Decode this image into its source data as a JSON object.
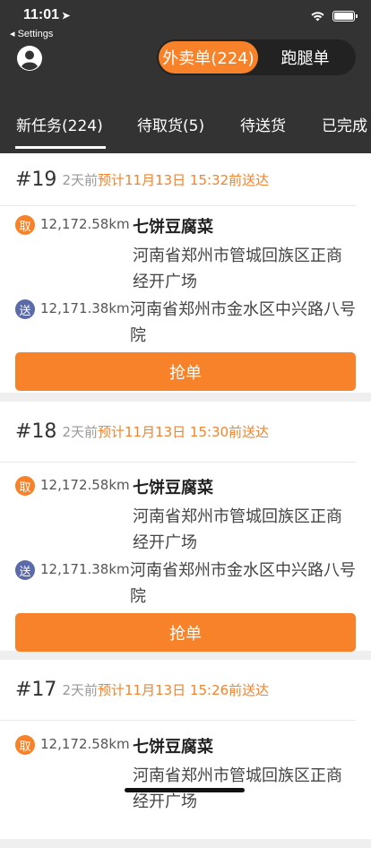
{
  "status_bar": {
    "time": "11:01",
    "back_app": "◂ Settings"
  },
  "header": {
    "segments": [
      {
        "label": "外卖单(224)",
        "active": true
      },
      {
        "label": "跑腿单",
        "active": false
      }
    ],
    "tabs": [
      {
        "label": "新任务(224)",
        "active": true
      },
      {
        "label": "待取货(5)",
        "active": false
      },
      {
        "label": "待送货",
        "active": false
      },
      {
        "label": "已完成",
        "active": false
      }
    ]
  },
  "orders": [
    {
      "number": "#19",
      "ago": "2天前",
      "eta": "预计11月13日 15:32前送达",
      "pickup_badge": "取",
      "pickup_distance": "12,172.58km",
      "shop_name": "七饼豆腐菜",
      "pickup_address_line1": "河南省郑州市管城回族区正商",
      "pickup_address_line2": "经开广场",
      "deliver_badge": "送",
      "deliver_distance": "12,171.38km",
      "deliver_address_line1": "河南省郑州市金水区中兴路八号",
      "deliver_address_line2": "院",
      "grab_label": "抢单"
    },
    {
      "number": "#18",
      "ago": "2天前",
      "eta": "预计11月13日 15:30前送达",
      "pickup_badge": "取",
      "pickup_distance": "12,172.58km",
      "shop_name": "七饼豆腐菜",
      "pickup_address_line1": "河南省郑州市管城回族区正商",
      "pickup_address_line2": "经开广场",
      "deliver_badge": "送",
      "deliver_distance": "12,171.38km",
      "deliver_address_line1": "河南省郑州市金水区中兴路八号",
      "deliver_address_line2": "院",
      "grab_label": "抢单"
    },
    {
      "number": "#17",
      "ago": "2天前",
      "eta": "预计11月13日 15:26前送达",
      "pickup_badge": "取",
      "pickup_distance": "12,172.58km",
      "shop_name": "七饼豆腐菜",
      "pickup_address_line1": "河南省郑州市管城回族区正商",
      "pickup_address_line2": "经开广场"
    }
  ],
  "colors": {
    "header_bg": "#333333",
    "accent": "#f7822a",
    "deliver_badge": "#5b6aa8",
    "page_bg": "#efefef"
  }
}
